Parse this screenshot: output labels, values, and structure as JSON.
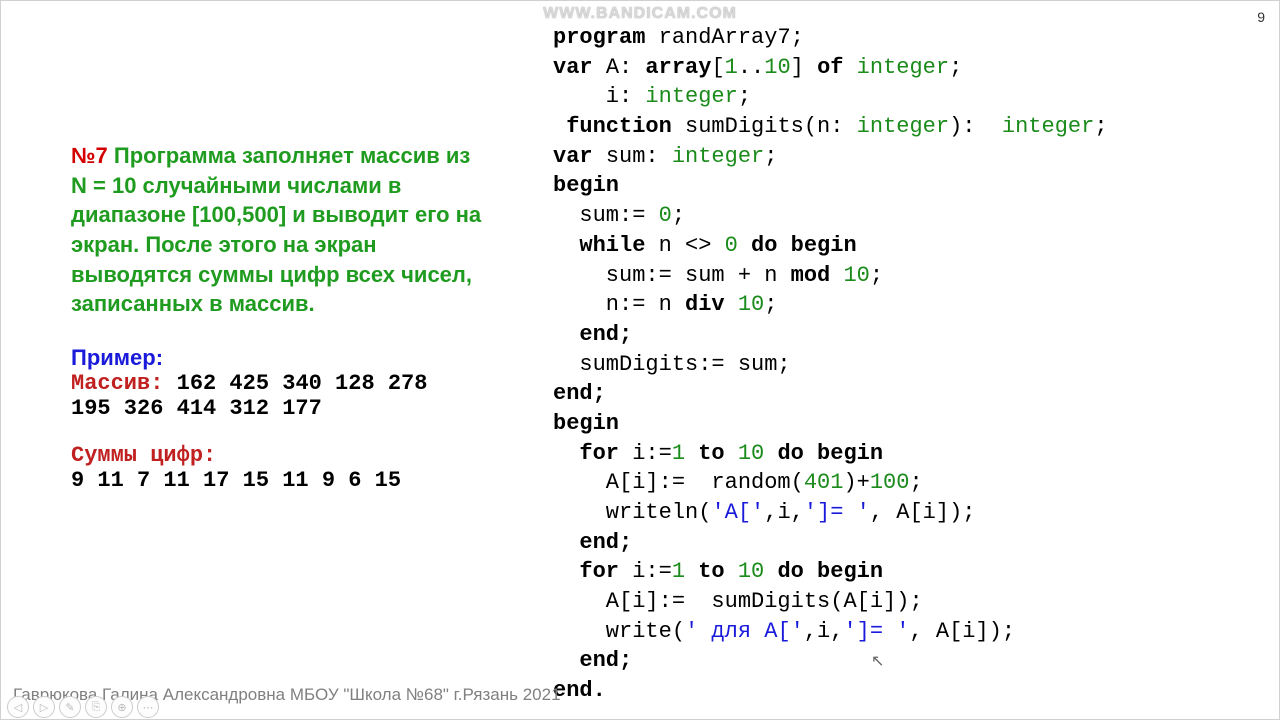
{
  "watermark": "WWW.BANDICAM.COM",
  "page_number": "9",
  "task": {
    "num": "№7",
    "text": " Программа заполняет массив из  N = 10 случайными числами в диапазоне [100,500] и выводит его на экран. После этого на экран выводятся суммы цифр всех чисел, записанных в массив."
  },
  "example": {
    "label": "Пример:",
    "array_label": "Массив:",
    "array_line1": " 162 425 340 128 278",
    "array_line2": "  195 326 414 312 177",
    "sums_label": "Суммы цифр:",
    "sums_values": "9 11 7 11 17 15 11 9 6 15"
  },
  "code": {
    "l1": {
      "a": "program ",
      "b": "randArray7;"
    },
    "l2": {
      "a": "var ",
      "b": "A: ",
      "c": "array",
      "d": "[",
      "e": "1",
      "f": "..",
      "g": "10",
      "h": "] ",
      "i": "of ",
      "j": "integer",
      "k": ";"
    },
    "l3": {
      "a": "    i: ",
      "b": "integer",
      "c": ";"
    },
    "l4": {
      "a": " function ",
      "b": "sumDigits(n: ",
      "c": "integer",
      "d": "):  ",
      "e": "integer",
      "f": ";"
    },
    "l5": {
      "a": "var ",
      "b": "sum: ",
      "c": "integer",
      "d": ";"
    },
    "l6": "begin",
    "l7": {
      "a": "  sum:= ",
      "b": "0",
      "c": ";"
    },
    "l8": {
      "a": "  while ",
      "b": "n <> ",
      "c": "0",
      "d": " do begin"
    },
    "l9": {
      "a": "    sum:= sum + n ",
      "b": "mod ",
      "c": "10",
      "d": ";"
    },
    "l10": {
      "a": "    n:= n ",
      "b": "div ",
      "c": "10",
      "d": ";"
    },
    "l11": "  end;",
    "l12": "  sumDigits:= sum;",
    "l13": "end;",
    "l14": "begin",
    "l15": {
      "a": "  for ",
      "b": "i:=",
      "c": "1",
      "d": " to ",
      "e": "10",
      "f": " do begin"
    },
    "l16": {
      "a": "    A[i]:=  random(",
      "b": "401",
      "c": ")+",
      "d": "100",
      "e": ";"
    },
    "l17": {
      "a": "    writeln(",
      "b": "'A['",
      "c": ",i,",
      "d": "']= '",
      "e": ", A[i]);"
    },
    "l18": "  end;",
    "l19": {
      "a": "  for ",
      "b": "i:=",
      "c": "1",
      "d": " to ",
      "e": "10",
      "f": " do begin"
    },
    "l20": "    A[i]:=  sumDigits(A[i]);",
    "l21": {
      "a": "    write(",
      "b": "' для A['",
      "c": ",i,",
      "d": "']= '",
      "e": ", A[i]);"
    },
    "l22": "  end;",
    "l23": "end."
  },
  "footer": "Гаврюкова Галина Александровна МБОУ \"Школа №68\" г.Рязань 2021",
  "toolbar": {
    "prev": "◁",
    "next": "▷",
    "pen": "✎",
    "copy": "⎘",
    "zoom": "⊕",
    "more": "⋯"
  }
}
